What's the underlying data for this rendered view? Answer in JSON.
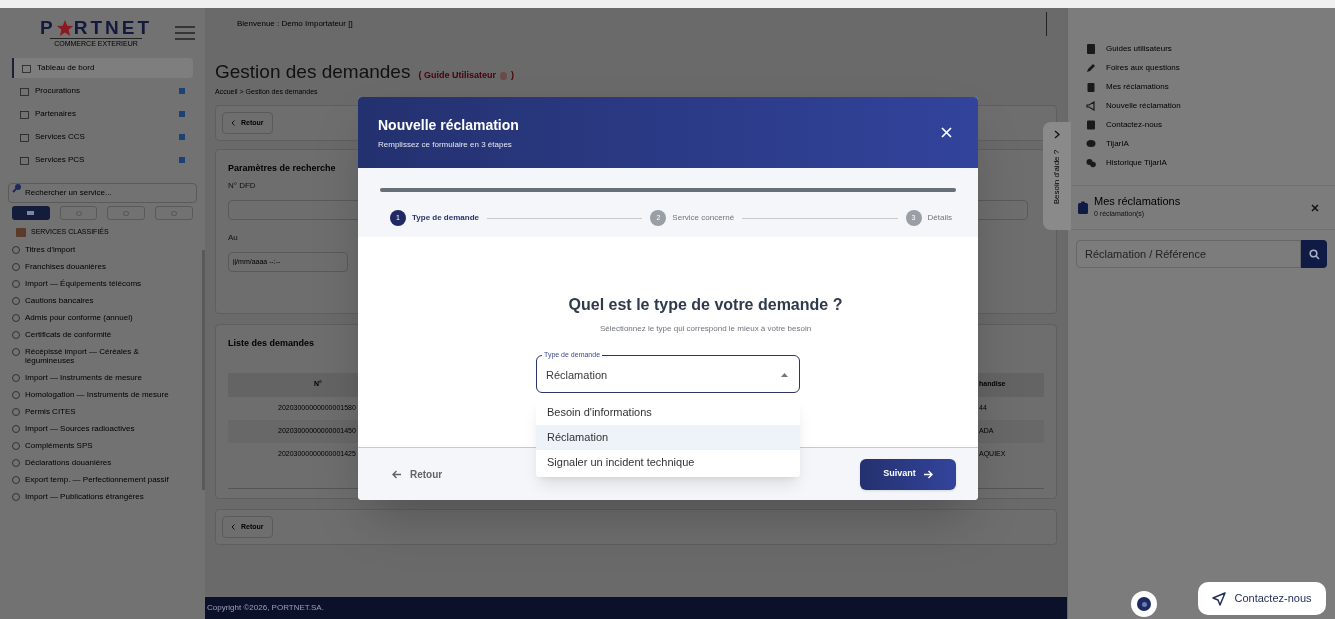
{
  "brand": {
    "logo_start": "P",
    "logo_end": "RTNET",
    "tagline": "COMMERCE EXTERIEUR"
  },
  "sidebar": {
    "menu": [
      {
        "label": "Tableau de bord",
        "selected": true,
        "expandable": false
      },
      {
        "label": "Procurations",
        "selected": false,
        "expandable": true
      },
      {
        "label": "Partenaires",
        "selected": false,
        "expandable": true
      },
      {
        "label": "Services CCS",
        "selected": false,
        "expandable": true
      },
      {
        "label": "Services PCS",
        "selected": false,
        "expandable": true
      }
    ],
    "search": {
      "placeholder": "Rechercher un service..."
    },
    "view_tabs": [
      {
        "selected": true
      },
      {
        "selected": false
      },
      {
        "selected": false
      },
      {
        "selected": false
      }
    ],
    "section_title": "SERVICES CLASSIFIÉS",
    "services": [
      "Titres d'import",
      "Franchises douanières",
      "Import — Équipements télécoms",
      "Cautions bancaires",
      "Admis pour conforme (annuel)",
      "Certificats de conformité",
      "Récépissé import — Céréales & légumineuses",
      "Import — Instruments de mesure",
      "Homologation — Instruments de mesure",
      "Permis CITES",
      "Import — Sources radioactives",
      "Compléments SPS",
      "Déclarations douanières",
      "Export temp. — Perfectionnement passif",
      "Import — Publications étrangères"
    ]
  },
  "header": {
    "welcome": "Bienvenue : Demo Importateur []"
  },
  "page": {
    "title": "Gestion des demandes",
    "guide_open": "( Guide Utilisateur",
    "guide_close": ")",
    "breadcrumb": "Accueil > Gestion des demandes",
    "back_top": "Retour",
    "back_bottom": "Retour",
    "search_panel": {
      "title": "Paramètres de recherche",
      "field_1_label": "N° DFD",
      "field_2_label": "Au",
      "field_2_placeholder": "jj/mm/aaaa --:--"
    },
    "list": {
      "title": "Liste des demandes",
      "columns": [
        "N°",
        "handise"
      ],
      "rows": [
        [
          "20203000000000001580",
          "44"
        ],
        [
          "20203000000000001450",
          "ADA"
        ],
        [
          "20203000000000001425",
          "AQUIEX"
        ]
      ]
    }
  },
  "footer": "Copyright ©2026, PORTNET.SA.",
  "help": {
    "tab": "Besoin d'aide ?",
    "links": [
      "Guides utilisateurs",
      "Foires aux questions",
      "Mes réclamations",
      "Nouvelle réclamation",
      "Contactez-nous",
      "TijarIA",
      "Historique TijarIA"
    ],
    "reclamations": {
      "title": "Mes réclamations",
      "count": "0 réclamation(s)",
      "search_placeholder": "Réclamation / Référence"
    }
  },
  "contact_button": "Contactez-nous",
  "modal": {
    "title": "Nouvelle réclamation",
    "subtitle": "Remplissez ce formulaire en 3 étapes",
    "steps": [
      {
        "number": "1",
        "label": "Type de demande",
        "selected": true
      },
      {
        "number": "2",
        "label": "Service concerné",
        "selected": false
      },
      {
        "number": "3",
        "label": "Détails",
        "selected": false
      }
    ],
    "question": "Quel est le type de votre demande ?",
    "hint": "Sélectionnez le type qui correspond le mieux à votre besoin",
    "select": {
      "label": "Type de demande",
      "value": "Réclamation",
      "expanded": true,
      "options": [
        {
          "label": "Besoin d'informations",
          "selected": false
        },
        {
          "label": "Réclamation",
          "selected": true
        },
        {
          "label": "Signaler un incident technique",
          "selected": false
        }
      ]
    },
    "back": "Retour",
    "next": "Suivant"
  }
}
